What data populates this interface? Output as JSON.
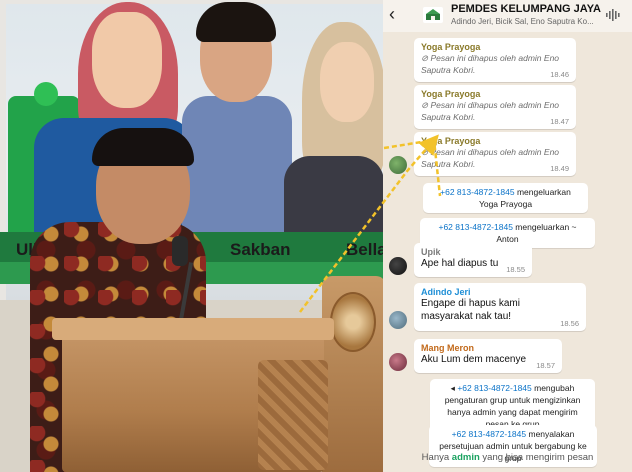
{
  "photo": {
    "banner_names": [
      "Ulil",
      "Sakban",
      "Bella"
    ]
  },
  "header": {
    "back_icon": "back-arrow-icon",
    "title": "PEMDES KELUMPANG JAYA",
    "subtitle": "Adindo Jeri, Bicik Sal, Eno Saputra Ko..."
  },
  "messages": [
    {
      "sender": "Yoga Prayoga",
      "deleted_text": "Pesan ini dihapus oleh admin Eno Saputra Kobri.",
      "time": "18.46"
    },
    {
      "sender": "Yoga Prayoga",
      "deleted_text": "Pesan ini dihapus oleh admin Eno Saputra Kobri.",
      "time": "18.47"
    },
    {
      "sender": "Yoga Prayoga",
      "deleted_text": "Pesan ini dihapus oleh admin Eno Saputra Kobri.",
      "time": "18.49"
    }
  ],
  "system_1": {
    "number": "+62 813-4872-1845",
    "text": " mengeluarkan Yoga Prayoga"
  },
  "system_2": {
    "number": "+62 813-4872-1845",
    "text": " mengeluarkan ~ Anton"
  },
  "chats": [
    {
      "sender": "Upik",
      "text": "Ape hal diapus tu",
      "time": "18.55"
    },
    {
      "sender": "Adindo Jeri",
      "text": "Engape di hapus kami masyarakat nak tau!",
      "time": "18.56"
    },
    {
      "sender": "Mang Meron",
      "text": "Aku Lum dem macenye",
      "time": "18.57"
    }
  ],
  "system_3": {
    "number": "+62 813-4872-1845",
    "text": " mengubah pengaturan grup untuk mengizinkan hanya admin yang dapat mengirim pesan ke grup"
  },
  "system_4": {
    "number": "+62 813-4872-1845",
    "text": " menyalakan persetujuan admin untuk bergabung ke grup"
  },
  "footer": {
    "prefix": "Hanya ",
    "highlight": "admin",
    "suffix": " yang bisa mengirim pesan"
  },
  "colors": {
    "yoga": "#8a7a2a",
    "upik": "#7a7a7a",
    "adindo": "#1f8fd6",
    "meron": "#c26a1b",
    "arrow": "#f2c22a",
    "link": "#0b73c8"
  }
}
